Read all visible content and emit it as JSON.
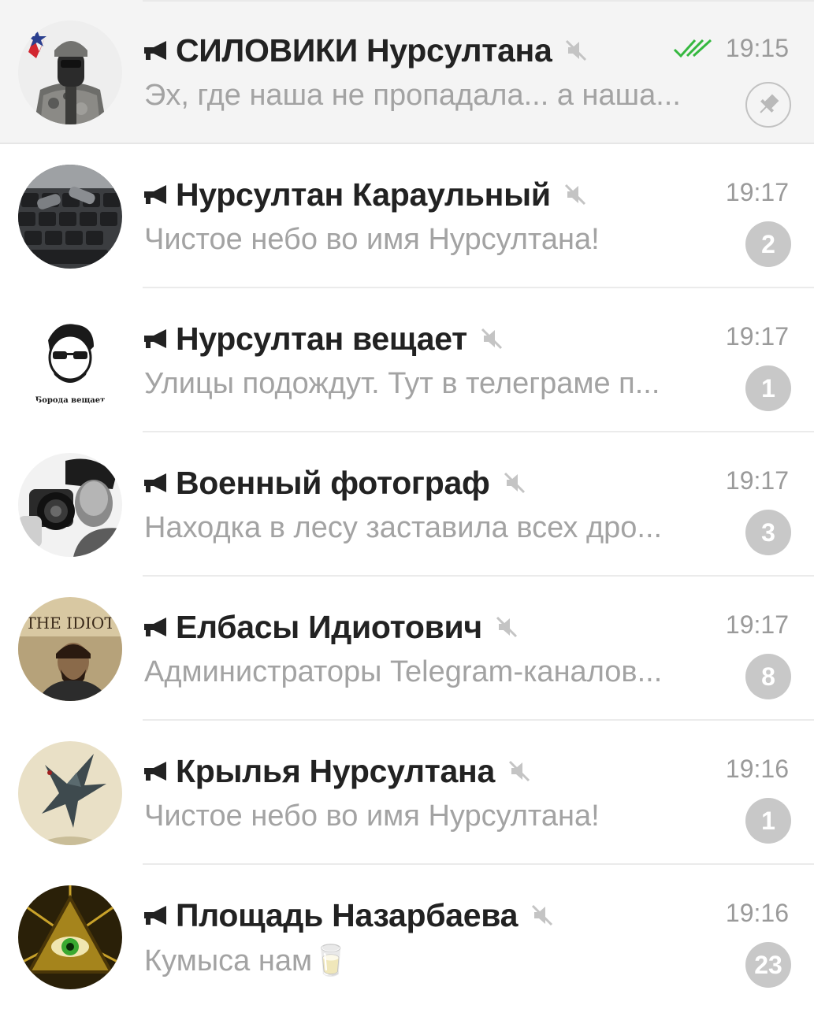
{
  "chats": [
    {
      "title": "СИЛОВИКИ Нурсултана",
      "time": "19:15",
      "preview": "Эх, где наша не пропадала... а наша...",
      "pinned": true,
      "read_status": "double-check",
      "channel_icon": "megaphone-icon",
      "muted_icon": "muted-icon",
      "avatar": "soldier-avatar"
    },
    {
      "title": "Нурсултан Караульный",
      "time": "19:17",
      "preview": "Чистое небо во имя Нурсултана!",
      "unread": "2",
      "channel_icon": "megaphone-icon",
      "muted_icon": "muted-icon",
      "avatar": "keyboard-cartridges-avatar"
    },
    {
      "title": "Нурсултан вещает",
      "time": "19:17",
      "preview": "Улицы подождут. Тут в телеграме п...",
      "unread": "1",
      "avatar_text": "Борода вещает",
      "channel_icon": "megaphone-icon",
      "muted_icon": "muted-icon",
      "avatar": "bearded-man-avatar"
    },
    {
      "title": "Военный фотограф",
      "time": "19:17",
      "preview": "Находка в лесу заставила всех дро...",
      "unread": "3",
      "channel_icon": "megaphone-icon",
      "muted_icon": "muted-icon",
      "avatar": "photographer-avatar"
    },
    {
      "title": "Елбасы Идиотович",
      "time": "19:17",
      "preview": "Администраторы Telegram-каналов...",
      "unread": "8",
      "avatar_text": "THE IDIOT",
      "channel_icon": "megaphone-icon",
      "muted_icon": "muted-icon",
      "avatar": "idiot-book-avatar"
    },
    {
      "title": "Крылья Нурсултана",
      "time": "19:16",
      "preview": "Чистое небо во имя Нурсултана!",
      "unread": "1",
      "channel_icon": "megaphone-icon",
      "muted_icon": "muted-icon",
      "avatar": "dragon-avatar"
    },
    {
      "title": "Площадь Назарбаева",
      "time": "19:16",
      "preview": "Кумыса нам🥛",
      "unread": "23",
      "channel_icon": "megaphone-icon",
      "muted_icon": "muted-icon",
      "avatar": "eye-pyramid-avatar"
    }
  ],
  "colors": {
    "check": "#35b83f",
    "badge": "#c8c8c8",
    "title": "#222222",
    "secondary": "#a3a3a3",
    "pinned_bg": "#f4f4f4"
  }
}
